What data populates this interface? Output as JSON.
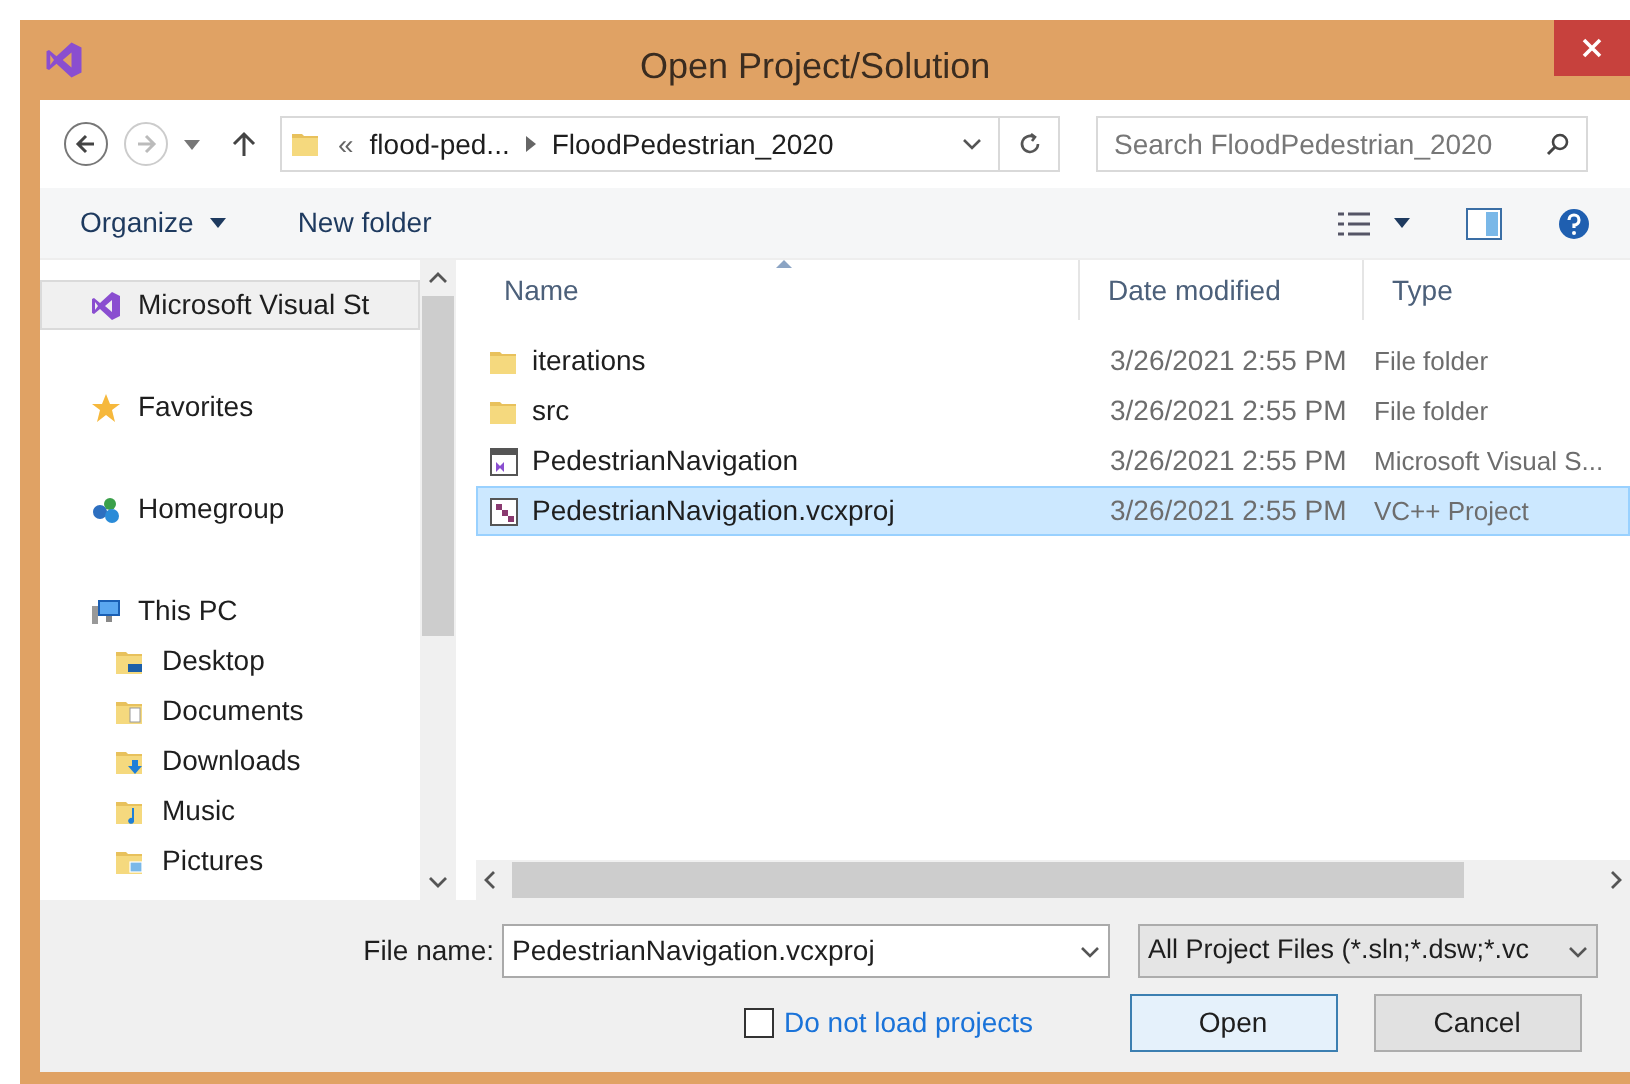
{
  "window": {
    "title": "Open Project/Solution"
  },
  "address": {
    "overflow": "«",
    "crumbs": [
      "flood-ped...",
      "FloodPedestrian_2020"
    ]
  },
  "search": {
    "placeholder": "Search FloodPedestrian_2020"
  },
  "toolbar": {
    "organize": "Organize",
    "new_folder": "New folder"
  },
  "nav": [
    {
      "label": "Microsoft Visual St",
      "kind": "vs",
      "selected": true
    },
    {
      "label": "Favorites",
      "kind": "star",
      "selected": false
    },
    {
      "label": "Homegroup",
      "kind": "homegroup",
      "selected": false
    },
    {
      "label": "This PC",
      "kind": "pc",
      "selected": false,
      "children": [
        {
          "label": "Desktop",
          "kind": "desktop",
          "selected": false
        },
        {
          "label": "Documents",
          "kind": "documents",
          "selected": false
        },
        {
          "label": "Downloads",
          "kind": "downloads",
          "selected": false
        },
        {
          "label": "Music",
          "kind": "music",
          "selected": false
        },
        {
          "label": "Pictures",
          "kind": "pictures",
          "selected": false
        }
      ]
    }
  ],
  "table": {
    "columns": [
      "Name",
      "Date modified",
      "Type"
    ],
    "rows": [
      {
        "name": "iterations",
        "date": "3/26/2021 2:55 PM",
        "type": "File folder",
        "kind": "folder",
        "selected": false
      },
      {
        "name": "src",
        "date": "3/26/2021 2:55 PM",
        "type": "File folder",
        "kind": "folder",
        "selected": false
      },
      {
        "name": "PedestrianNavigation",
        "date": "3/26/2021 2:55 PM",
        "type": "Microsoft Visual S...",
        "kind": "solution",
        "selected": false
      },
      {
        "name": "PedestrianNavigation.vcxproj",
        "date": "3/26/2021 2:55 PM",
        "type": "VC++ Project",
        "kind": "project",
        "selected": true
      }
    ]
  },
  "file_name": {
    "label": "File name:",
    "value": "PedestrianNavigation.vcxproj"
  },
  "filter": {
    "value": "All Project Files (*.sln;*.dsw;*.vc"
  },
  "do_not_load": {
    "label": "Do not load projects",
    "checked": false
  },
  "buttons": [
    "Open",
    "Cancel"
  ]
}
